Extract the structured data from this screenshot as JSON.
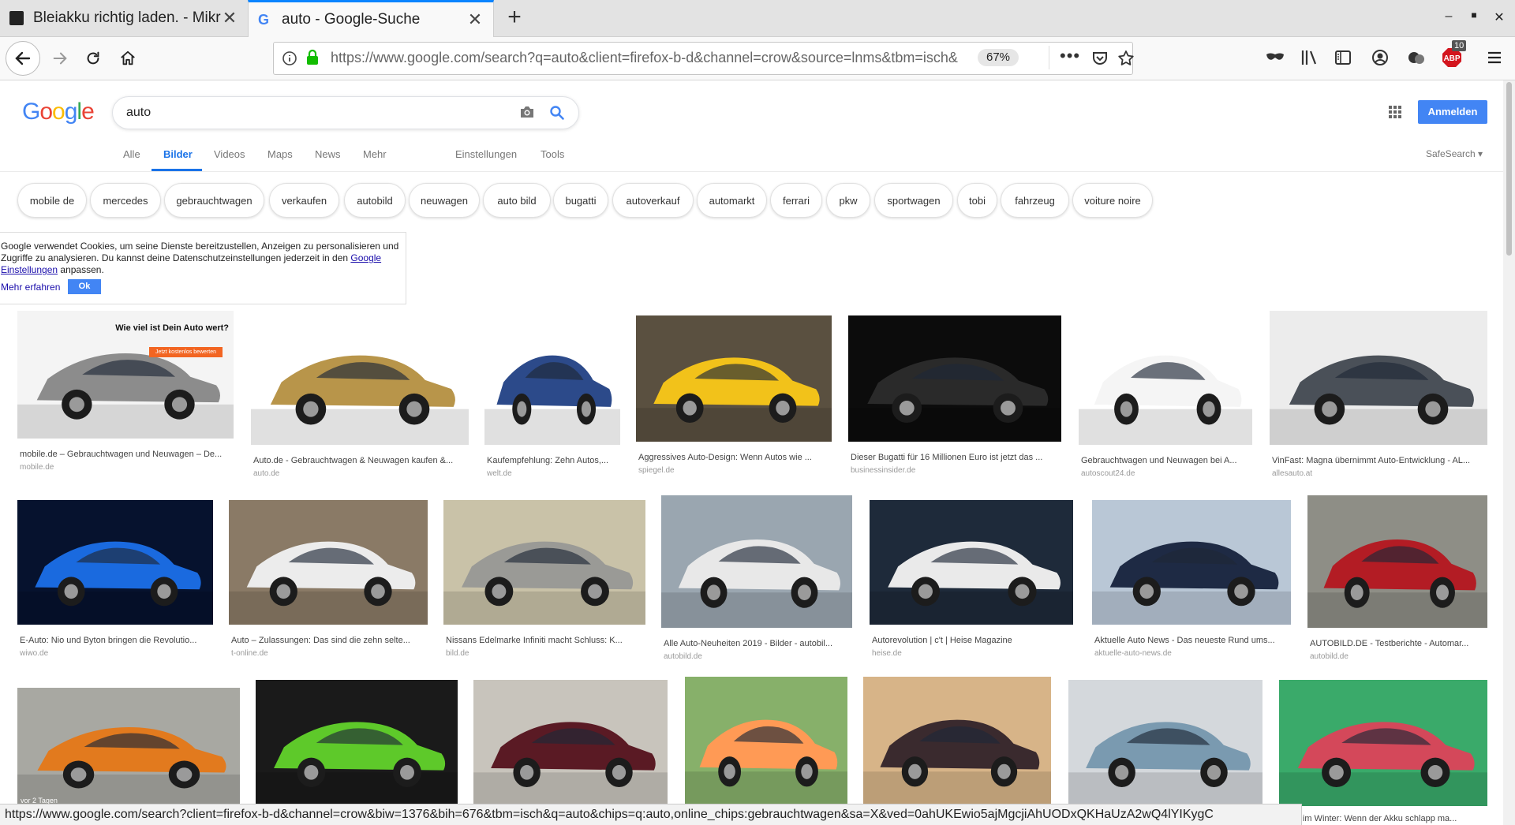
{
  "browser": {
    "tabs": [
      {
        "title": "Bleiakku richtig laden. - Mikroc",
        "active": false
      },
      {
        "title": "auto - Google-Suche",
        "active": true
      }
    ],
    "new_tab_label": "+",
    "url": "https://www.google.com/search?q=auto&client=firefox-b-d&channel=crow&source=lnms&tbm=isch&",
    "zoom": "67%",
    "badge_count": "10",
    "status_url": "https://www.google.com/search?client=firefox-b-d&channel=crow&biw=1376&bih=676&tbm=isch&q=auto&chips=q:auto,online_chips:gebrauchtwagen&sa=X&ved=0ahUKEwio5ajMgcjiAhUODxQKHaUzA2wQ4lYIKygC"
  },
  "google": {
    "logo": [
      "G",
      "o",
      "o",
      "g",
      "l",
      "e"
    ],
    "logo_colors": [
      "#4285f4",
      "#ea4335",
      "#fbbc05",
      "#4285f4",
      "#34a853",
      "#ea4335"
    ],
    "query": "auto",
    "signin_label": "Anmelden",
    "tabs": [
      "Alle",
      "Bilder",
      "Videos",
      "Maps",
      "News",
      "Mehr"
    ],
    "settings_label": "Einstellungen",
    "tools_label": "Tools",
    "safesearch_label": "SafeSearch ▾",
    "chips": [
      "mobile de",
      "mercedes",
      "gebrauchtwagen",
      "verkaufen",
      "autobild",
      "neuwagen",
      "auto bild",
      "bugatti",
      "autoverkauf",
      "automarkt",
      "ferrari",
      "pkw",
      "sportwagen",
      "tobi",
      "fahrzeug",
      "voiture noire"
    ]
  },
  "cookie": {
    "text_before_link": "Google verwendet Cookies, um seine Dienste bereitzustellen, Anzeigen zu personalisieren und Zugriffe zu analysieren. Du kannst deine Datenschutzeinstellungen jederzeit in den ",
    "link": "Google Einstellungen",
    "text_after_link": " anpassen.",
    "more_label": "Mehr erfahren",
    "ok_label": "Ok"
  },
  "results": [
    {
      "caption": "mobile.de – Gebrauchtwagen und Neuwagen – De...",
      "source": "mobile.de",
      "car_color": "#8c8c8c",
      "bg": "#f4f4f4",
      "overlay_title": "Wie viel ist Dein Auto wert?",
      "overlay_button": "Jetzt kostenlos bewerten"
    },
    {
      "caption": "Auto.de - Gebrauchtwagen & Neuwagen kaufen &...",
      "source": "auto.de",
      "car_color": "#b8954a",
      "bg": "#ffffff"
    },
    {
      "caption": "Kaufempfehlung: Zehn Autos,...",
      "source": "welt.de",
      "car_color": "#2c4a8a",
      "bg": "#ffffff"
    },
    {
      "caption": "Aggressives Auto-Design: Wenn Autos wie ...",
      "source": "spiegel.de",
      "car_color": "#f2c21a",
      "bg": "#5a5040"
    },
    {
      "caption": "Dieser Bugatti für 16 Millionen Euro ist jetzt das ...",
      "source": "businessinsider.de",
      "car_color": "#2a2a2a",
      "bg": "#0c0c0c"
    },
    {
      "caption": "Gebrauchtwagen und Neuwagen bei A...",
      "source": "autoscout24.de",
      "car_color": "#f5f5f5",
      "bg": "#ffffff"
    },
    {
      "caption": "VinFast: Magna übernimmt Auto-Entwicklung - AL...",
      "source": "allesauto.at",
      "car_color": "#4a5058",
      "bg": "#ececec"
    },
    {
      "caption": "E-Auto: Nio und Byton bringen die Revolutio...",
      "source": "wiwo.de",
      "car_color": "#1a6adf",
      "bg": "#06122e"
    },
    {
      "caption": "Auto – Zulassungen: Das sind die zehn selte...",
      "source": "t-online.de",
      "car_color": "#ececec",
      "bg": "#8a7a66"
    },
    {
      "caption": "Nissans Edelmarke Infiniti macht Schluss: K...",
      "source": "bild.de",
      "car_color": "#9a9a96",
      "bg": "#c9c2a8"
    },
    {
      "caption": "Alle Auto-Neuheiten 2019 - Bilder - autobil...",
      "source": "autobild.de",
      "car_color": "#e8e8e8",
      "bg": "#9aa6b0"
    },
    {
      "caption": "Autorevolution | c't | Heise Magazine",
      "source": "heise.de",
      "car_color": "#eaeaea",
      "bg": "#1e2a3a"
    },
    {
      "caption": "Aktuelle Auto News - Das neueste Rund ums...",
      "source": "aktuelle-auto-news.de",
      "car_color": "#1e2a44",
      "bg": "#b9c7d6"
    },
    {
      "caption": "AUTOBILD.DE - Testberichte - Automar...",
      "source": "autobild.de",
      "car_color": "#b31c24",
      "bg": "#8e8e86"
    },
    {
      "caption": "",
      "source": "",
      "car_color": "#e27a1e",
      "bg": "#a8a8a2",
      "overlay_text": "vor 2 Tagen"
    },
    {
      "caption": "",
      "source": "",
      "car_color": "#5ec92a",
      "bg": "#1a1a1a"
    },
    {
      "caption": "",
      "source": "",
      "car_color": "#5a1a24",
      "bg": "#c8c4bc"
    },
    {
      "caption": "",
      "source": "",
      "car_color": "#ff9a55",
      "bg": "#87b06a"
    },
    {
      "caption": "",
      "source": "",
      "car_color": "#3a2a2e",
      "bg": "#d7b488"
    },
    {
      "caption": "",
      "source": "",
      "car_color": "#7a9ab0",
      "bg": "#d4d8dc"
    },
    {
      "caption": "...tos im Winter: Wenn der Akku schlapp ma...",
      "source": "",
      "car_color": "#d4485a",
      "bg": "#3aaa6a"
    }
  ]
}
